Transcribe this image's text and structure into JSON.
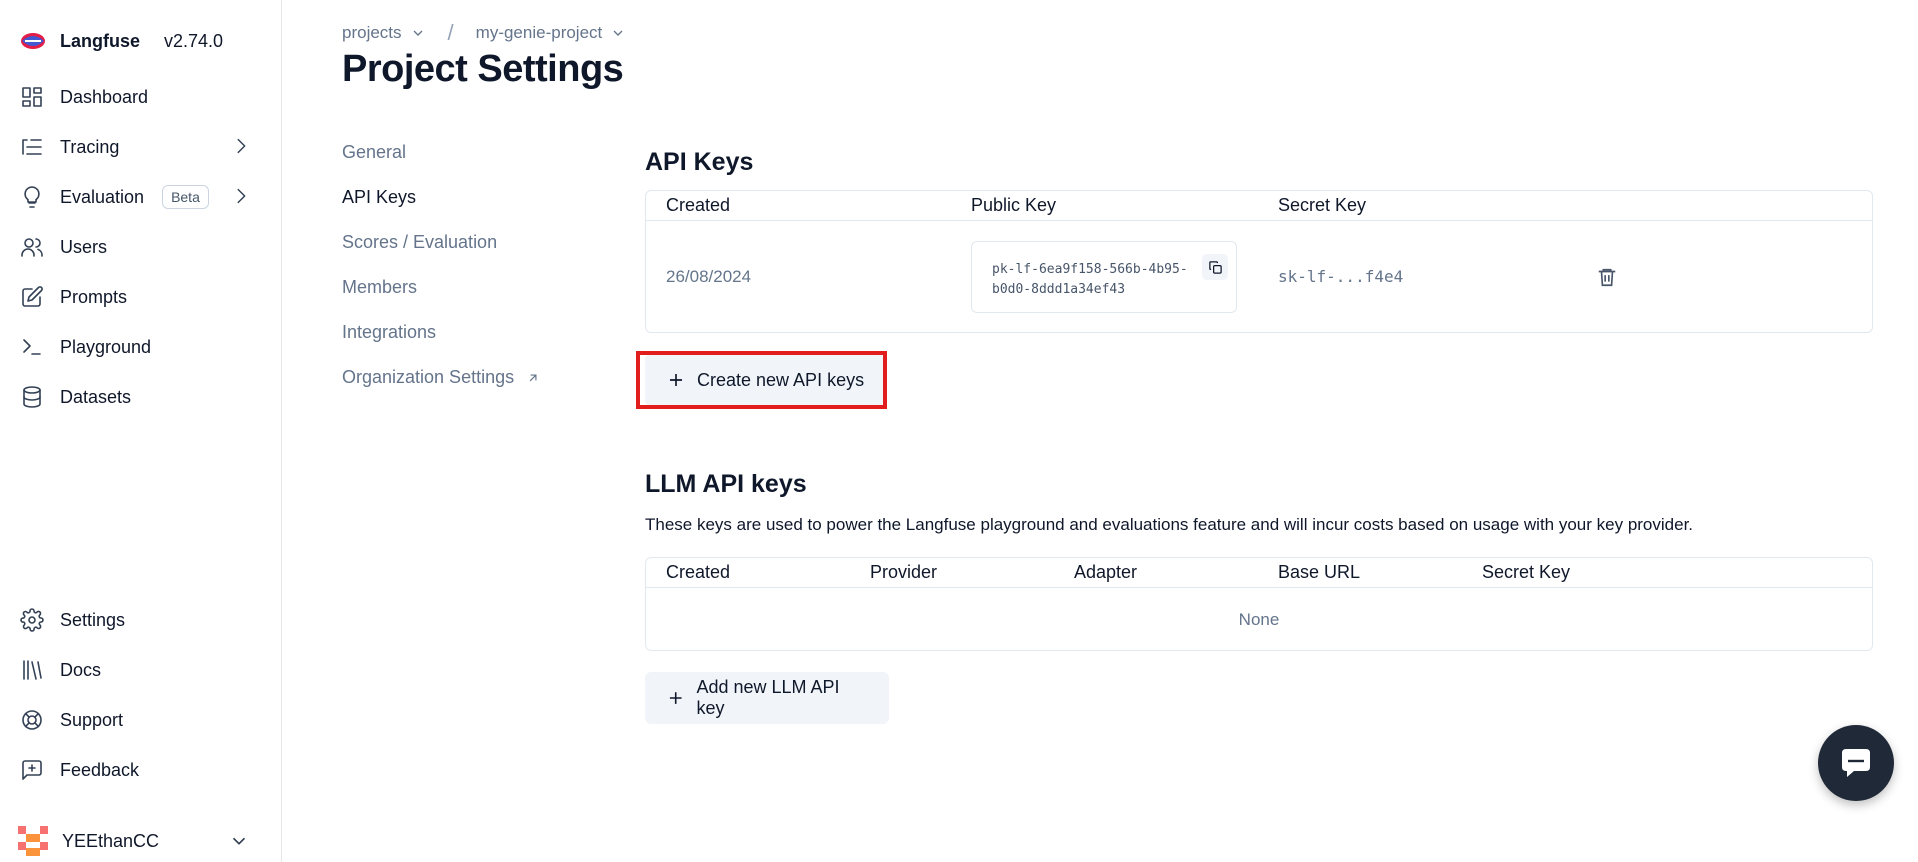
{
  "brand": {
    "name": "Langfuse",
    "version": "v2.74.0"
  },
  "sidebar": {
    "items": [
      {
        "label": "Dashboard",
        "icon": "dashboard-icon"
      },
      {
        "label": "Tracing",
        "icon": "tracing-icon",
        "has_chevron": true
      },
      {
        "label": "Evaluation",
        "icon": "lightbulb-icon",
        "badge": "Beta",
        "has_chevron": true
      },
      {
        "label": "Users",
        "icon": "users-icon"
      },
      {
        "label": "Prompts",
        "icon": "prompts-icon"
      },
      {
        "label": "Playground",
        "icon": "terminal-icon"
      },
      {
        "label": "Datasets",
        "icon": "database-icon"
      }
    ],
    "bottom_items": [
      {
        "label": "Settings",
        "icon": "gear-icon"
      },
      {
        "label": "Docs",
        "icon": "library-icon"
      },
      {
        "label": "Support",
        "icon": "lifebuoy-icon"
      },
      {
        "label": "Feedback",
        "icon": "feedback-icon"
      }
    ],
    "user": {
      "name": "YEEthanCC"
    }
  },
  "breadcrumb": {
    "org": "projects",
    "project": "my-genie-project",
    "separator": "/"
  },
  "page_title": "Project Settings",
  "subnav": {
    "items": [
      {
        "label": "General"
      },
      {
        "label": "API Keys",
        "active": true
      },
      {
        "label": "Scores / Evaluation"
      },
      {
        "label": "Members"
      },
      {
        "label": "Integrations"
      },
      {
        "label": "Organization Settings",
        "external": true
      }
    ]
  },
  "api_keys": {
    "title": "API Keys",
    "columns": [
      "Created",
      "Public Key",
      "Secret Key"
    ],
    "rows": [
      {
        "created": "26/08/2024",
        "public_key": "pk-lf-6ea9f158-566b-4b95-b0d0-8ddd1a34ef43",
        "secret_key": "sk-lf-...f4e4"
      }
    ],
    "create_button": "Create new API keys"
  },
  "llm_keys": {
    "title": "LLM API keys",
    "description": "These keys are used to power the Langfuse playground and evaluations feature and will incur costs based on usage with your key provider.",
    "columns": [
      "Created",
      "Provider",
      "Adapter",
      "Base URL",
      "Secret Key"
    ],
    "empty_text": "None",
    "add_button": "Add new LLM API key"
  },
  "colors": {
    "highlight": "#e11d1d",
    "button_bg": "#f1f5f9",
    "chat_fab": "#1f2937"
  }
}
